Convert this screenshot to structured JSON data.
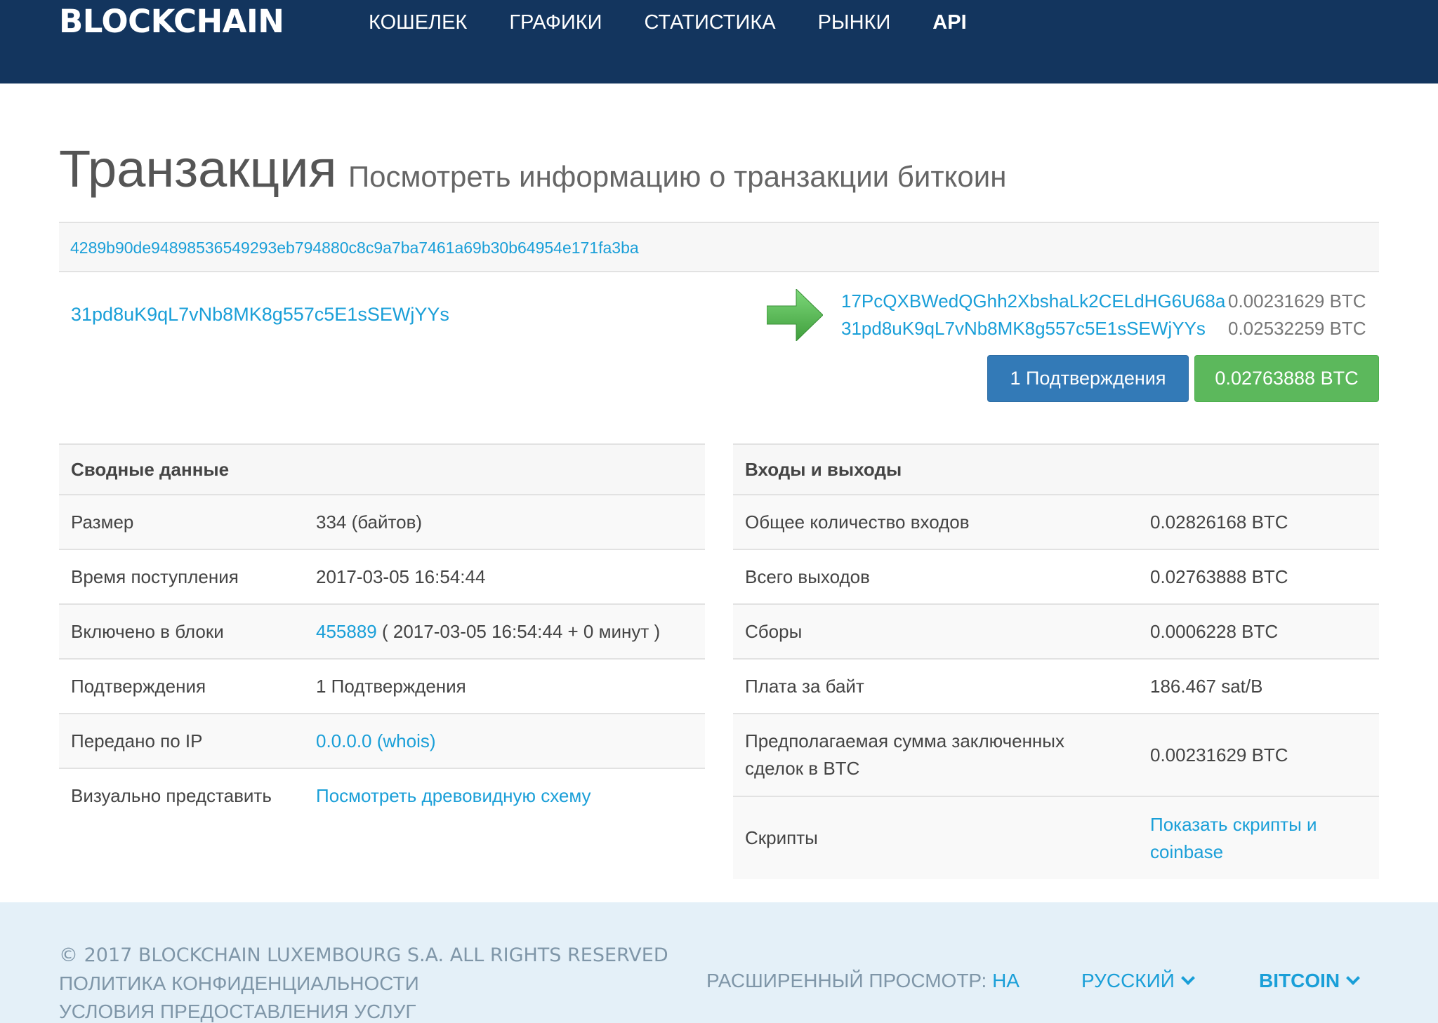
{
  "header": {
    "brand": "BLOCKCHAIN",
    "nav": [
      "КОШЕЛЕК",
      "ГРАФИКИ",
      "СТАТИСТИКА",
      "РЫНКИ",
      "API"
    ]
  },
  "page": {
    "title": "Транзакция",
    "subtitle": "Посмотреть информацию о транзакции биткоин"
  },
  "tx": {
    "hash": "4289b90de94898536549293eb794880c8c9a7ba7461a69b30b64954e171fa3ba",
    "input_address": "31pd8uK9qL7vNb8MK8g557c5E1sSEWjYYs",
    "outputs": [
      {
        "address": "17PcQXBWedQGhh2XbshaLk2CELdHG6U68a",
        "amount": "0.00231629 BTC"
      },
      {
        "address": "31pd8uK9qL7vNb8MK8g557c5E1sSEWjYYs",
        "amount": "0.02532259 BTC"
      }
    ],
    "confirmations_button": "1 Подтверждения",
    "total_button": "0.02763888 BTC"
  },
  "summary": {
    "heading": "Сводные данные",
    "rows": [
      {
        "label": "Размер",
        "value": "334 (байтов)"
      },
      {
        "label": "Время поступления",
        "value": "2017-03-05 16:54:44"
      },
      {
        "label": "Включено в блоки",
        "block": "455889",
        "value": " ( 2017-03-05 16:54:44 + 0 минут )"
      },
      {
        "label": "Подтверждения",
        "value": "1 Подтверждения"
      },
      {
        "label": "Передано по IP",
        "value": "0.0.0.0 (whois)"
      },
      {
        "label": "Визуально представить",
        "value": "Посмотреть древовидную схему"
      }
    ]
  },
  "io": {
    "heading": "Входы и выходы",
    "rows": [
      {
        "label": "Общее количество входов",
        "value": "0.02826168 BTC"
      },
      {
        "label": "Всего выходов",
        "value": "0.02763888 BTC"
      },
      {
        "label": "Сборы",
        "value": "0.0006228 BTC"
      },
      {
        "label": "Плата за байт",
        "value": "186.467 sat/B"
      },
      {
        "label": "Предполагаемая сумма заключенных сделок в BTC",
        "value": "0.00231629 BTC"
      },
      {
        "label": "Скрипты",
        "value": "Показать скрипты и coinbase"
      }
    ]
  },
  "footer": {
    "copyright": "© 2017 BLOCKCHAIN LUXEMBOURG S.A. ALL RIGHTS RESERVED",
    "privacy": "ПОЛИТИКА КОНФИДЕНЦИАЛЬНОСТИ",
    "terms": "УСЛОВИЯ ПРЕДОСТАВЛЕНИЯ УСЛУГ",
    "advanced_label": "РАСШИРЕННЫЙ ПРОСМОТР:",
    "advanced_value": "НА",
    "language": "РУССКИЙ",
    "currency": "BITCOIN"
  },
  "colors": {
    "navbar": "#13355e",
    "link": "#1a9fd8",
    "confirm_button": "#337ab7",
    "amount_button": "#5cb85c",
    "footer": "#e4f0f8"
  }
}
